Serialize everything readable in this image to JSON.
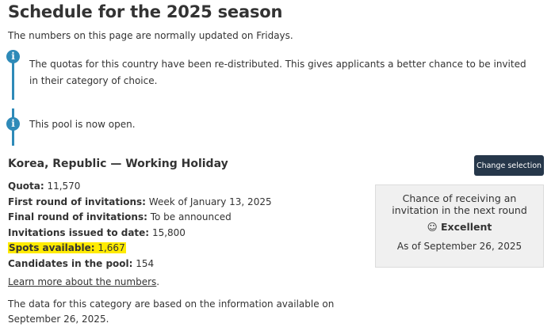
{
  "page": {
    "title": "Schedule for the 2025 season",
    "subtitle": "The numbers on this page are normally updated on Fridays."
  },
  "alerts": [
    {
      "icon": "info-icon",
      "text": "The quotas for this country have been re-distributed. This gives applicants a better chance to be invited in their category of choice."
    },
    {
      "icon": "info-icon",
      "text": "This pool is now open."
    }
  ],
  "section": {
    "title": "Korea, Republic — Working Holiday",
    "change_button": "Change selection"
  },
  "details": {
    "quota_label": "Quota:",
    "quota_value": "11,570",
    "first_round_label": "First round of invitations:",
    "first_round_value": "Week of January 13, 2025",
    "final_round_label": "Final round of invitations:",
    "final_round_value": "To be announced",
    "issued_label": "Invitations issued to date:",
    "issued_value": "15,800",
    "spots_label": "Spots available:",
    "spots_value": "1,667",
    "candidates_label": "Candidates in the pool:",
    "candidates_value": "154"
  },
  "learn_more": {
    "link": "Learn more about the numbers",
    "suffix": "."
  },
  "footnote": "The data for this category are based on the information available on September 26, 2025.",
  "chance": {
    "title": "Chance of receiving an invitation in the next round",
    "icon": "smile-icon",
    "rating": "Excellent",
    "as_of": "As of September 26, 2025"
  },
  "colors": {
    "accent": "#2e8ab8",
    "button": "#26374a",
    "highlight": "#ffeb00",
    "box": "#f0f0f0"
  }
}
